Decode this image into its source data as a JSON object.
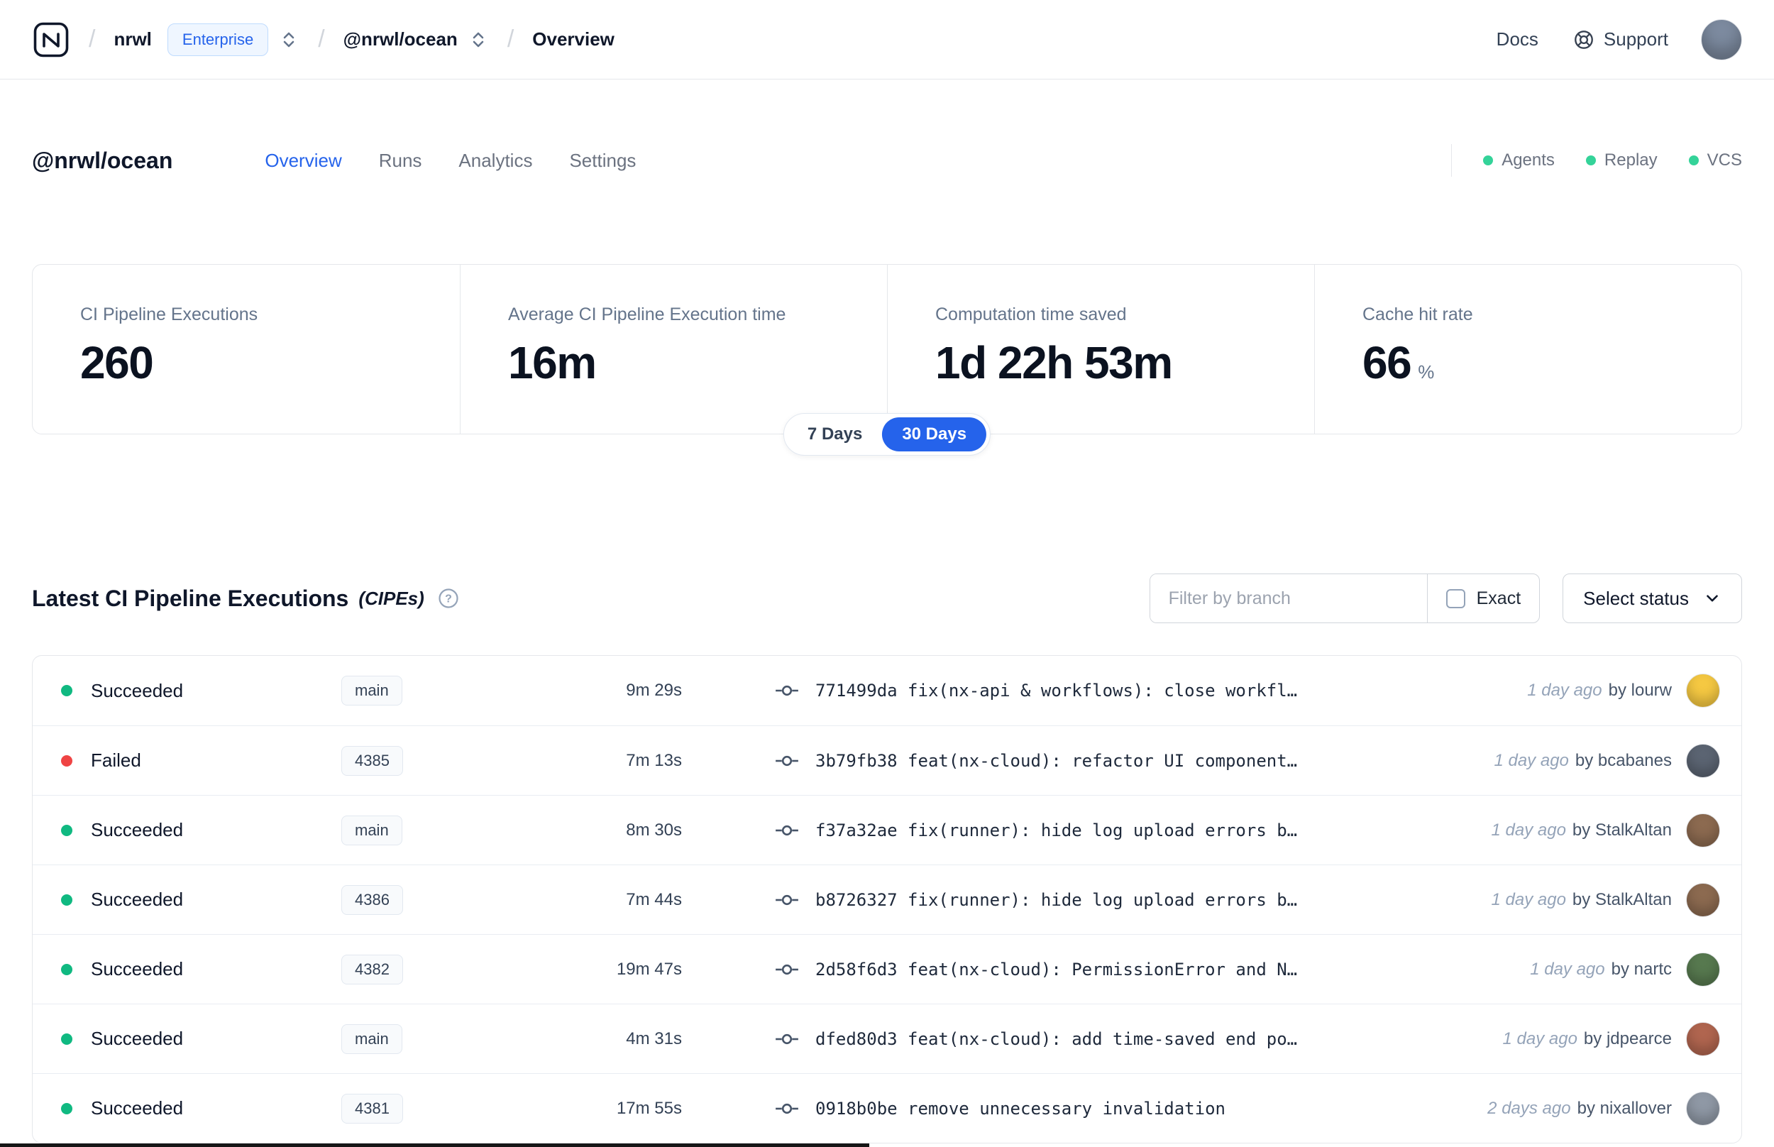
{
  "theme": {
    "accent_blue": "#2563eb",
    "green": "#10b981",
    "red": "#ef4444"
  },
  "navbar": {
    "breadcrumb": {
      "org": "nrwl",
      "org_badge": "Enterprise",
      "workspace": "@nrwl/ocean",
      "page": "Overview"
    },
    "docs_label": "Docs",
    "support_label": "Support",
    "avatar_color": "#7d8ba0"
  },
  "header": {
    "title": "@nrwl/ocean",
    "tabs": [
      {
        "label": "Overview",
        "active": true
      },
      {
        "label": "Runs",
        "active": false
      },
      {
        "label": "Analytics",
        "active": false
      },
      {
        "label": "Settings",
        "active": false
      }
    ],
    "statuses": [
      {
        "label": "Agents"
      },
      {
        "label": "Replay"
      },
      {
        "label": "VCS"
      }
    ]
  },
  "stats": {
    "cards": [
      {
        "label": "CI Pipeline Executions",
        "value": "260"
      },
      {
        "label": "Average CI Pipeline Execution time",
        "value": "16m"
      },
      {
        "label": "Computation time saved",
        "value": "1d 22h 53m"
      },
      {
        "label": "Cache hit rate",
        "value": "66",
        "suffix": "%"
      }
    ],
    "range": {
      "options": [
        {
          "label": "7 Days",
          "active": false
        },
        {
          "label": "30 Days",
          "active": true
        }
      ]
    }
  },
  "cipes": {
    "title": "Latest CI Pipeline Executions",
    "subtitle": "(CIPEs)",
    "filter_placeholder": "Filter by branch",
    "exact_label": "Exact",
    "status_select_label": "Select status",
    "rows": [
      {
        "state": "succeeded",
        "status": "Succeeded",
        "branch": "main",
        "duration": "9m 29s",
        "commit": "771499da",
        "message": "fix(nx-api & workflows): close workfl…",
        "time": "1 day ago",
        "author": "by lourw",
        "avatar_color": "#f5c842"
      },
      {
        "state": "failed",
        "status": "Failed",
        "branch": "4385",
        "duration": "7m 13s",
        "commit": "3b79fb38",
        "message": "feat(nx-cloud): refactor UI component…",
        "time": "1 day ago",
        "author": "by bcabanes",
        "avatar_color": "#5b6472"
      },
      {
        "state": "succeeded",
        "status": "Succeeded",
        "branch": "main",
        "duration": "8m 30s",
        "commit": "f37a32ae",
        "message": "fix(runner): hide log upload errors b…",
        "time": "1 day ago",
        "author": "by StalkAltan",
        "avatar_color": "#8c6a50"
      },
      {
        "state": "succeeded",
        "status": "Succeeded",
        "branch": "4386",
        "duration": "7m 44s",
        "commit": "b8726327",
        "message": "fix(runner): hide log upload errors b…",
        "time": "1 day ago",
        "author": "by StalkAltan",
        "avatar_color": "#8c6a50"
      },
      {
        "state": "succeeded",
        "status": "Succeeded",
        "branch": "4382",
        "duration": "19m 47s",
        "commit": "2d58f6d3",
        "message": "feat(nx-cloud): PermissionError and N…",
        "time": "1 day ago",
        "author": "by nartc",
        "avatar_color": "#57794f"
      },
      {
        "state": "succeeded",
        "status": "Succeeded",
        "branch": "main",
        "duration": "4m 31s",
        "commit": "dfed80d3",
        "message": "feat(nx-cloud): add time-saved end po…",
        "time": "1 day ago",
        "author": "by jdpearce",
        "avatar_color": "#b0654f"
      },
      {
        "state": "succeeded",
        "status": "Succeeded",
        "branch": "4381",
        "duration": "17m 55s",
        "commit": "0918b0be",
        "message": "remove unnecessary invalidation",
        "time": "2 days ago",
        "author": "by nixallover",
        "avatar_color": "#8f98a5"
      }
    ]
  }
}
